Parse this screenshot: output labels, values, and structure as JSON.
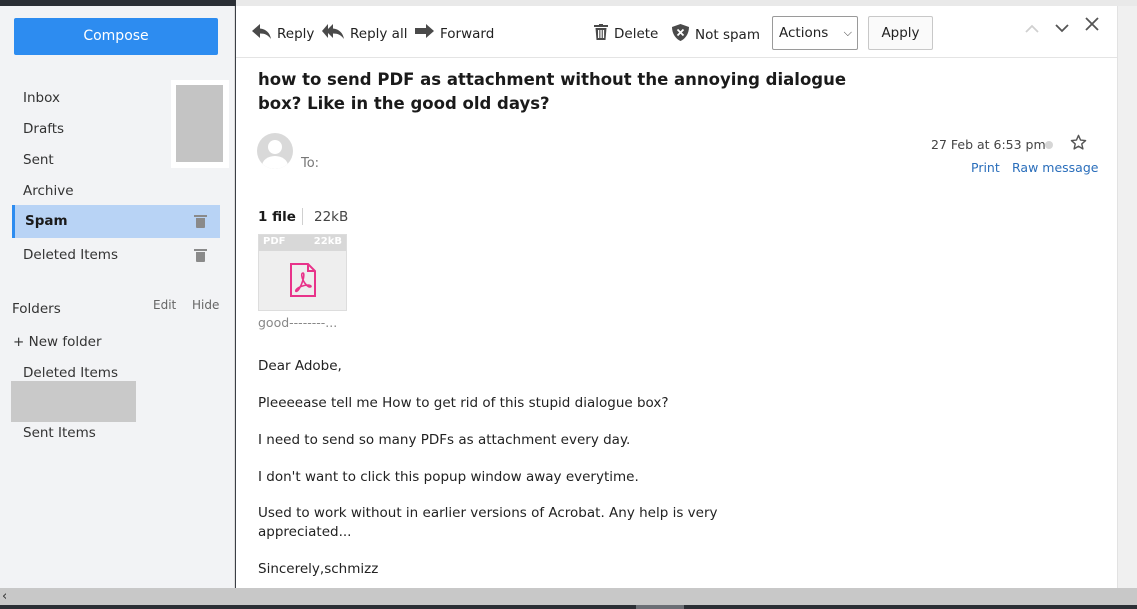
{
  "sidebar": {
    "compose_label": "Compose",
    "items": [
      {
        "label": "Inbox"
      },
      {
        "label": "Drafts"
      },
      {
        "label": "Sent"
      },
      {
        "label": "Archive"
      },
      {
        "label": "Spam",
        "active": true
      },
      {
        "label": "Deleted Items"
      }
    ],
    "folders": {
      "title": "Folders",
      "edit_label": "Edit",
      "hide_label": "Hide",
      "new_folder_label": "+ New folder",
      "items": [
        {
          "label": "Deleted Items"
        },
        {
          "label": "Sent Items"
        }
      ]
    }
  },
  "toolbar": {
    "reply_label": "Reply",
    "reply_all_label": "Reply all",
    "forward_label": "Forward",
    "delete_label": "Delete",
    "not_spam_label": "Not spam",
    "actions_value": "Actions",
    "apply_label": "Apply"
  },
  "message": {
    "subject": "how to send PDF as attachment without the annoying dialogue box? Like in the good old days?",
    "to_label": "To:",
    "date": "27 Feb at 6:53 pm",
    "print_label": "Print",
    "raw_label": "Raw message",
    "attachments": {
      "count_label": "1 file",
      "total_size": "22kB",
      "file": {
        "type": "PDF",
        "size": "22kB",
        "name": "good--------..."
      }
    },
    "body_lines": [
      "Dear Adobe,",
      "Pleeeease tell me How to get rid of this stupid dialogue box?",
      "I need to send so many PDFs as attachment every day.",
      "I don't want to click this popup window away everytime.",
      "Used to work without in earlier versions of Acrobat. Any help is very",
      "appreciated...",
      "Sincerely,schmizz"
    ]
  },
  "colors": {
    "accent": "#2d8cf0",
    "active_item_bg": "#b8d3f5",
    "pdf_icon": "#e8338a",
    "link": "#2a6ebb"
  }
}
